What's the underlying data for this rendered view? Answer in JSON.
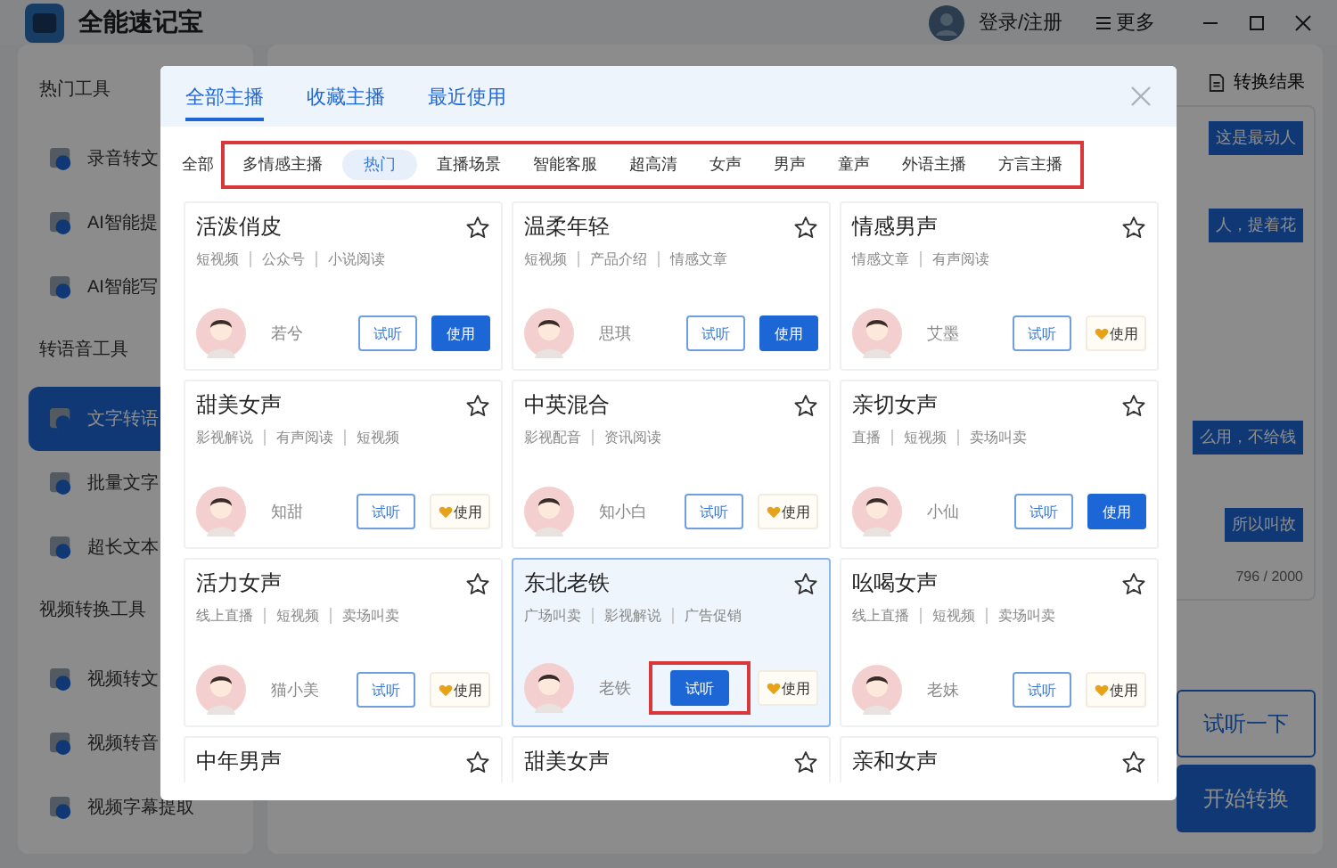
{
  "window": {
    "title": "全能速记宝",
    "login": "登录/注册",
    "more": "更多"
  },
  "sidebar": {
    "sections": [
      {
        "title": "热门工具",
        "items": [
          {
            "label": "录音转文",
            "selected": false
          },
          {
            "label": "AI智能提",
            "selected": false
          },
          {
            "label": "AI智能写",
            "selected": false
          }
        ]
      },
      {
        "title": "转语音工具",
        "items": [
          {
            "label": "文字转语",
            "selected": true
          },
          {
            "label": "批量文字",
            "selected": false
          },
          {
            "label": "超长文本",
            "selected": false
          }
        ]
      },
      {
        "title": "视频转换工具",
        "items": [
          {
            "label": "视频转文",
            "selected": false
          },
          {
            "label": "视频转音",
            "selected": false
          },
          {
            "label": "视频字幕提取",
            "selected": false
          }
        ]
      }
    ]
  },
  "main": {
    "result_button": "转换结果",
    "snippets": [
      "这是最动人",
      "人，提着花",
      "么用，不给钱",
      "所以叫故"
    ],
    "counter": "796 / 2000",
    "listen_button": "试听一下",
    "start_button": "开始转换"
  },
  "dialog": {
    "tabs": [
      {
        "label": "全部主播",
        "selected": true
      },
      {
        "label": "收藏主播",
        "selected": false
      },
      {
        "label": "最近使用",
        "selected": false
      }
    ],
    "all_filter": "全部",
    "categories": [
      {
        "label": "多情感主播",
        "selected": false
      },
      {
        "label": "热门",
        "selected": true
      },
      {
        "label": "直播场景",
        "selected": false
      },
      {
        "label": "智能客服",
        "selected": false
      },
      {
        "label": "超高清",
        "selected": false
      },
      {
        "label": "女声",
        "selected": false
      },
      {
        "label": "男声",
        "selected": false
      },
      {
        "label": "童声",
        "selected": false
      },
      {
        "label": "外语主播",
        "selected": false
      },
      {
        "label": "方言主播",
        "selected": false
      }
    ],
    "voices": [
      {
        "title": "活泼俏皮",
        "tags": [
          "短视频",
          "公众号",
          "小说阅读"
        ],
        "name": "若兮",
        "listen_label": "试听",
        "use_label": "使用",
        "vip": false,
        "selected": false,
        "listen_active": false,
        "marked": false
      },
      {
        "title": "温柔年轻",
        "tags": [
          "短视频",
          "产品介绍",
          "情感文章"
        ],
        "name": "思琪",
        "listen_label": "试听",
        "use_label": "使用",
        "vip": false,
        "selected": false,
        "listen_active": false,
        "marked": false
      },
      {
        "title": "情感男声",
        "tags": [
          "情感文章",
          "有声阅读"
        ],
        "name": "艾墨",
        "listen_label": "试听",
        "use_label": "使用",
        "vip": true,
        "selected": false,
        "listen_active": false,
        "marked": false
      },
      {
        "title": "甜美女声",
        "tags": [
          "影视解说",
          "有声阅读",
          "短视频"
        ],
        "name": "知甜",
        "listen_label": "试听",
        "use_label": "使用",
        "vip": true,
        "selected": false,
        "listen_active": false,
        "marked": false
      },
      {
        "title": "中英混合",
        "tags": [
          "影视配音",
          "资讯阅读"
        ],
        "name": "知小白",
        "listen_label": "试听",
        "use_label": "使用",
        "vip": true,
        "selected": false,
        "listen_active": false,
        "marked": false
      },
      {
        "title": "亲切女声",
        "tags": [
          "直播",
          "短视频",
          "卖场叫卖"
        ],
        "name": "小仙",
        "listen_label": "试听",
        "use_label": "使用",
        "vip": false,
        "selected": false,
        "listen_active": false,
        "marked": false
      },
      {
        "title": "活力女声",
        "tags": [
          "线上直播",
          "短视频",
          "卖场叫卖"
        ],
        "name": "猫小美",
        "listen_label": "试听",
        "use_label": "使用",
        "vip": true,
        "selected": false,
        "listen_active": false,
        "marked": false
      },
      {
        "title": "东北老铁",
        "tags": [
          "广场叫卖",
          "影视解说",
          "广告促销"
        ],
        "name": "老铁",
        "listen_label": "试听",
        "use_label": "使用",
        "vip": true,
        "selected": true,
        "listen_active": true,
        "marked": true
      },
      {
        "title": "吆喝女声",
        "tags": [
          "线上直播",
          "短视频",
          "卖场叫卖"
        ],
        "name": "老妹",
        "listen_label": "试听",
        "use_label": "使用",
        "vip": true,
        "selected": false,
        "listen_active": false,
        "marked": false
      },
      {
        "title": "中年男声"
      },
      {
        "title": "甜美女声"
      },
      {
        "title": "亲和女声"
      }
    ]
  }
}
